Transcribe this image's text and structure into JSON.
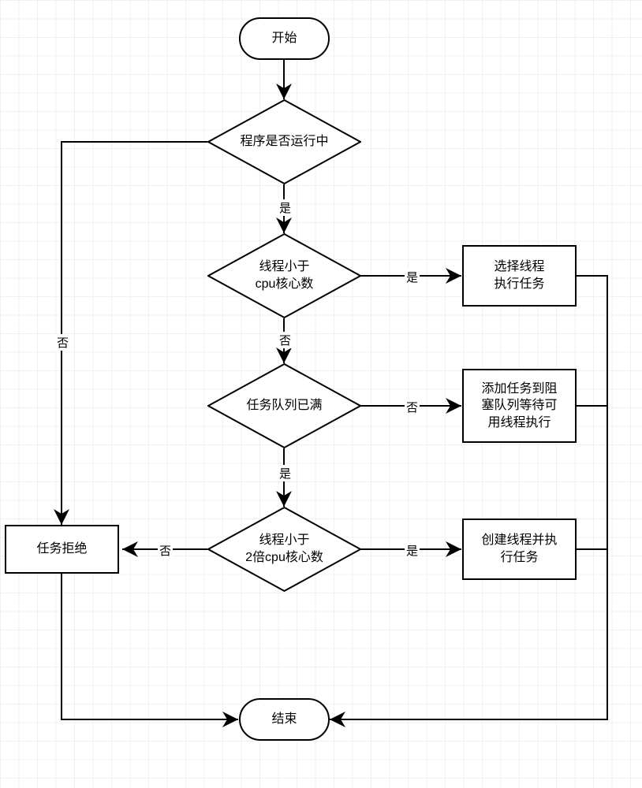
{
  "nodes": {
    "start": "开始",
    "d1": "程序是否运行中",
    "d2": "线程小于\ncpu核心数",
    "d3": "任务队列已满",
    "d4": "线程小于\n2倍cpu核心数",
    "reject": "任务拒绝",
    "p1": "选择线程\n执行任务",
    "p2": "添加任务到阻\n塞队列等待可\n用线程执行",
    "p3": "创建线程并执\n行任务",
    "end": "结束"
  },
  "labels": {
    "yes": "是",
    "no": "否"
  },
  "chart_data": {
    "type": "flowchart",
    "title": "",
    "nodes": [
      {
        "id": "start",
        "type": "terminator",
        "text": "开始"
      },
      {
        "id": "d1",
        "type": "decision",
        "text": "程序是否运行中"
      },
      {
        "id": "d2",
        "type": "decision",
        "text": "线程小于cpu核心数"
      },
      {
        "id": "d3",
        "type": "decision",
        "text": "任务队列已满"
      },
      {
        "id": "d4",
        "type": "decision",
        "text": "线程小于2倍cpu核心数"
      },
      {
        "id": "reject",
        "type": "process",
        "text": "任务拒绝"
      },
      {
        "id": "p1",
        "type": "process",
        "text": "选择线程执行任务"
      },
      {
        "id": "p2",
        "type": "process",
        "text": "添加任务到阻塞队列等待可用线程执行"
      },
      {
        "id": "p3",
        "type": "process",
        "text": "创建线程并执行任务"
      },
      {
        "id": "end",
        "type": "terminator",
        "text": "结束"
      }
    ],
    "edges": [
      {
        "from": "start",
        "to": "d1",
        "label": ""
      },
      {
        "from": "d1",
        "to": "d2",
        "label": "是"
      },
      {
        "from": "d1",
        "to": "reject",
        "label": "否"
      },
      {
        "from": "d2",
        "to": "p1",
        "label": "是"
      },
      {
        "from": "d2",
        "to": "d3",
        "label": "否"
      },
      {
        "from": "d3",
        "to": "p2",
        "label": "否"
      },
      {
        "from": "d3",
        "to": "d4",
        "label": "是"
      },
      {
        "from": "d4",
        "to": "p3",
        "label": "是"
      },
      {
        "from": "d4",
        "to": "reject",
        "label": "否"
      },
      {
        "from": "reject",
        "to": "end",
        "label": ""
      },
      {
        "from": "p1",
        "to": "end",
        "label": ""
      },
      {
        "from": "p2",
        "to": "end",
        "label": ""
      },
      {
        "from": "p3",
        "to": "end",
        "label": ""
      }
    ]
  }
}
